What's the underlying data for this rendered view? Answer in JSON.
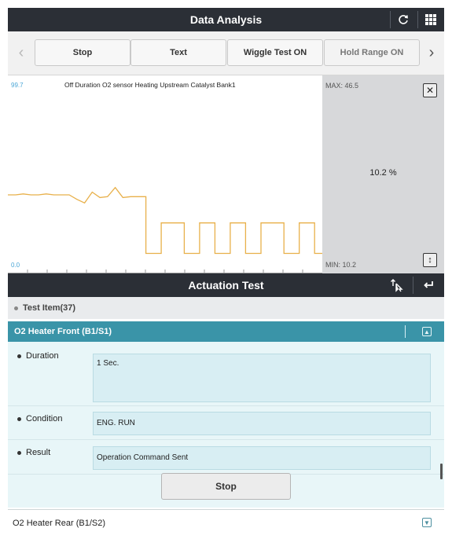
{
  "header": {
    "title": "Data Analysis",
    "refresh_icon": "refresh-icon",
    "grid_icon": "grid-icon"
  },
  "toolbar": {
    "buttons": [
      {
        "label": "Stop"
      },
      {
        "label": "Text"
      },
      {
        "label": "Wiggle Test ON"
      },
      {
        "label": "Hold Range ON"
      }
    ],
    "prev_icon": "chevron-left-icon",
    "next_icon": "chevron-right-icon"
  },
  "graph": {
    "title": "Off Duration O2 sensor Heating Upstream Catalyst Bank1",
    "y_top": "99.7",
    "y_bottom": "0.0",
    "max_label": "MAX: 46.5",
    "min_label": "MIN: 10.2",
    "current_value": "10.2 %",
    "line_color": "#e8b04a",
    "close_icon": "close-icon",
    "resize_icon": "vertical-resize-icon"
  },
  "chart_data": {
    "type": "line",
    "title": "Off Duration O2 sensor Heating Upstream Catalyst Bank1",
    "xlabel": "",
    "ylabel": "",
    "ylim": [
      0.0,
      99.7
    ],
    "grid": false,
    "series": [
      {
        "values": [
          42.5,
          42.5,
          43,
          42.5,
          42.5,
          43,
          42.5,
          42.5,
          42.5,
          40,
          38,
          44,
          41,
          41.5,
          46.5,
          41,
          41.5,
          41.5,
          10.2,
          10.2,
          27,
          27,
          27,
          10.2,
          10.2,
          27,
          27,
          10.2,
          10.2,
          27,
          27,
          10.2,
          10.2,
          27,
          27,
          27,
          10.2,
          10.2,
          27,
          27,
          10.2,
          10.2
        ]
      }
    ]
  },
  "actuation": {
    "title": "Actuation Test",
    "select_icon": "select-arrows-icon",
    "back_icon": "return-icon",
    "test_item_label": "Test Item(37)",
    "group_title": "O2 Heater Front (B1/S1)",
    "collapse_icon": "collapse-icon",
    "rows": [
      {
        "label": "Duration",
        "value": "1 Sec."
      },
      {
        "label": "Condition",
        "value": "ENG. RUN"
      },
      {
        "label": "Result",
        "value": "Operation Command Sent"
      }
    ],
    "stop_label": "Stop",
    "next_item": "O2 Heater Rear (B1/S2)",
    "expand_icon": "expand-icon"
  },
  "colors": {
    "header_bg": "#2b2f36",
    "accent_teal": "#3a94a8",
    "detail_bg": "#e8f6f8"
  }
}
